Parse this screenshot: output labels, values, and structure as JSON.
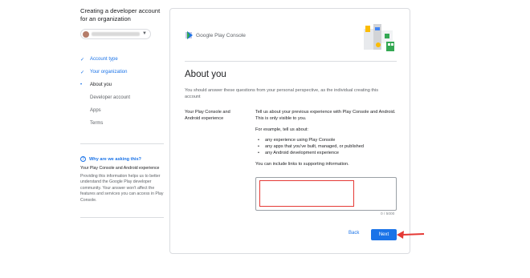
{
  "sidebar": {
    "title": "Creating a developer account for an organization",
    "account_chip": {
      "email_obscured": ""
    },
    "steps": [
      {
        "label": "Account type",
        "state": "done",
        "mark": "✓"
      },
      {
        "label": "Your organization",
        "state": "done",
        "mark": "✓"
      },
      {
        "label": "About you",
        "state": "current",
        "mark": "•"
      },
      {
        "label": "Developer account",
        "state": "sub",
        "mark": ""
      },
      {
        "label": "Apps",
        "state": "sub",
        "mark": ""
      },
      {
        "label": "Terms",
        "state": "sub",
        "mark": ""
      }
    ],
    "why": {
      "heading": "Why are we asking this?",
      "subheading": "Your Play Console and Android experience",
      "body": "Providing this information helps us to better understand the Google Play developer community. Your answer won't affect the features and services you can access in Play Console."
    }
  },
  "card": {
    "brand": "Google Play Console",
    "heading": "About you",
    "intro": "You should answer these questions from your personal perspective, as the individual creating this account",
    "question_label": "Your Play Console and Android experience",
    "question_text": "Tell us about your previous experience with Play Console and Android. This is only visible to you.",
    "example_intro": "For example, tell us about:",
    "bullets": [
      "any experience using Play Console",
      "any apps that you've built, managed, or published",
      "any Android development experience"
    ],
    "links_note": "You can include links to supporting information.",
    "textarea_value": "",
    "counter": "0 / 5000",
    "back_label": "Back",
    "next_label": "Next"
  },
  "colors": {
    "accent": "#1a73e8",
    "annotation": "#e53935"
  },
  "icons": {
    "done": "check-icon",
    "current": "dot-icon",
    "help": "help-circle-icon",
    "brand": "google-play-console-logo",
    "dropdown": "chevron-down-icon"
  }
}
